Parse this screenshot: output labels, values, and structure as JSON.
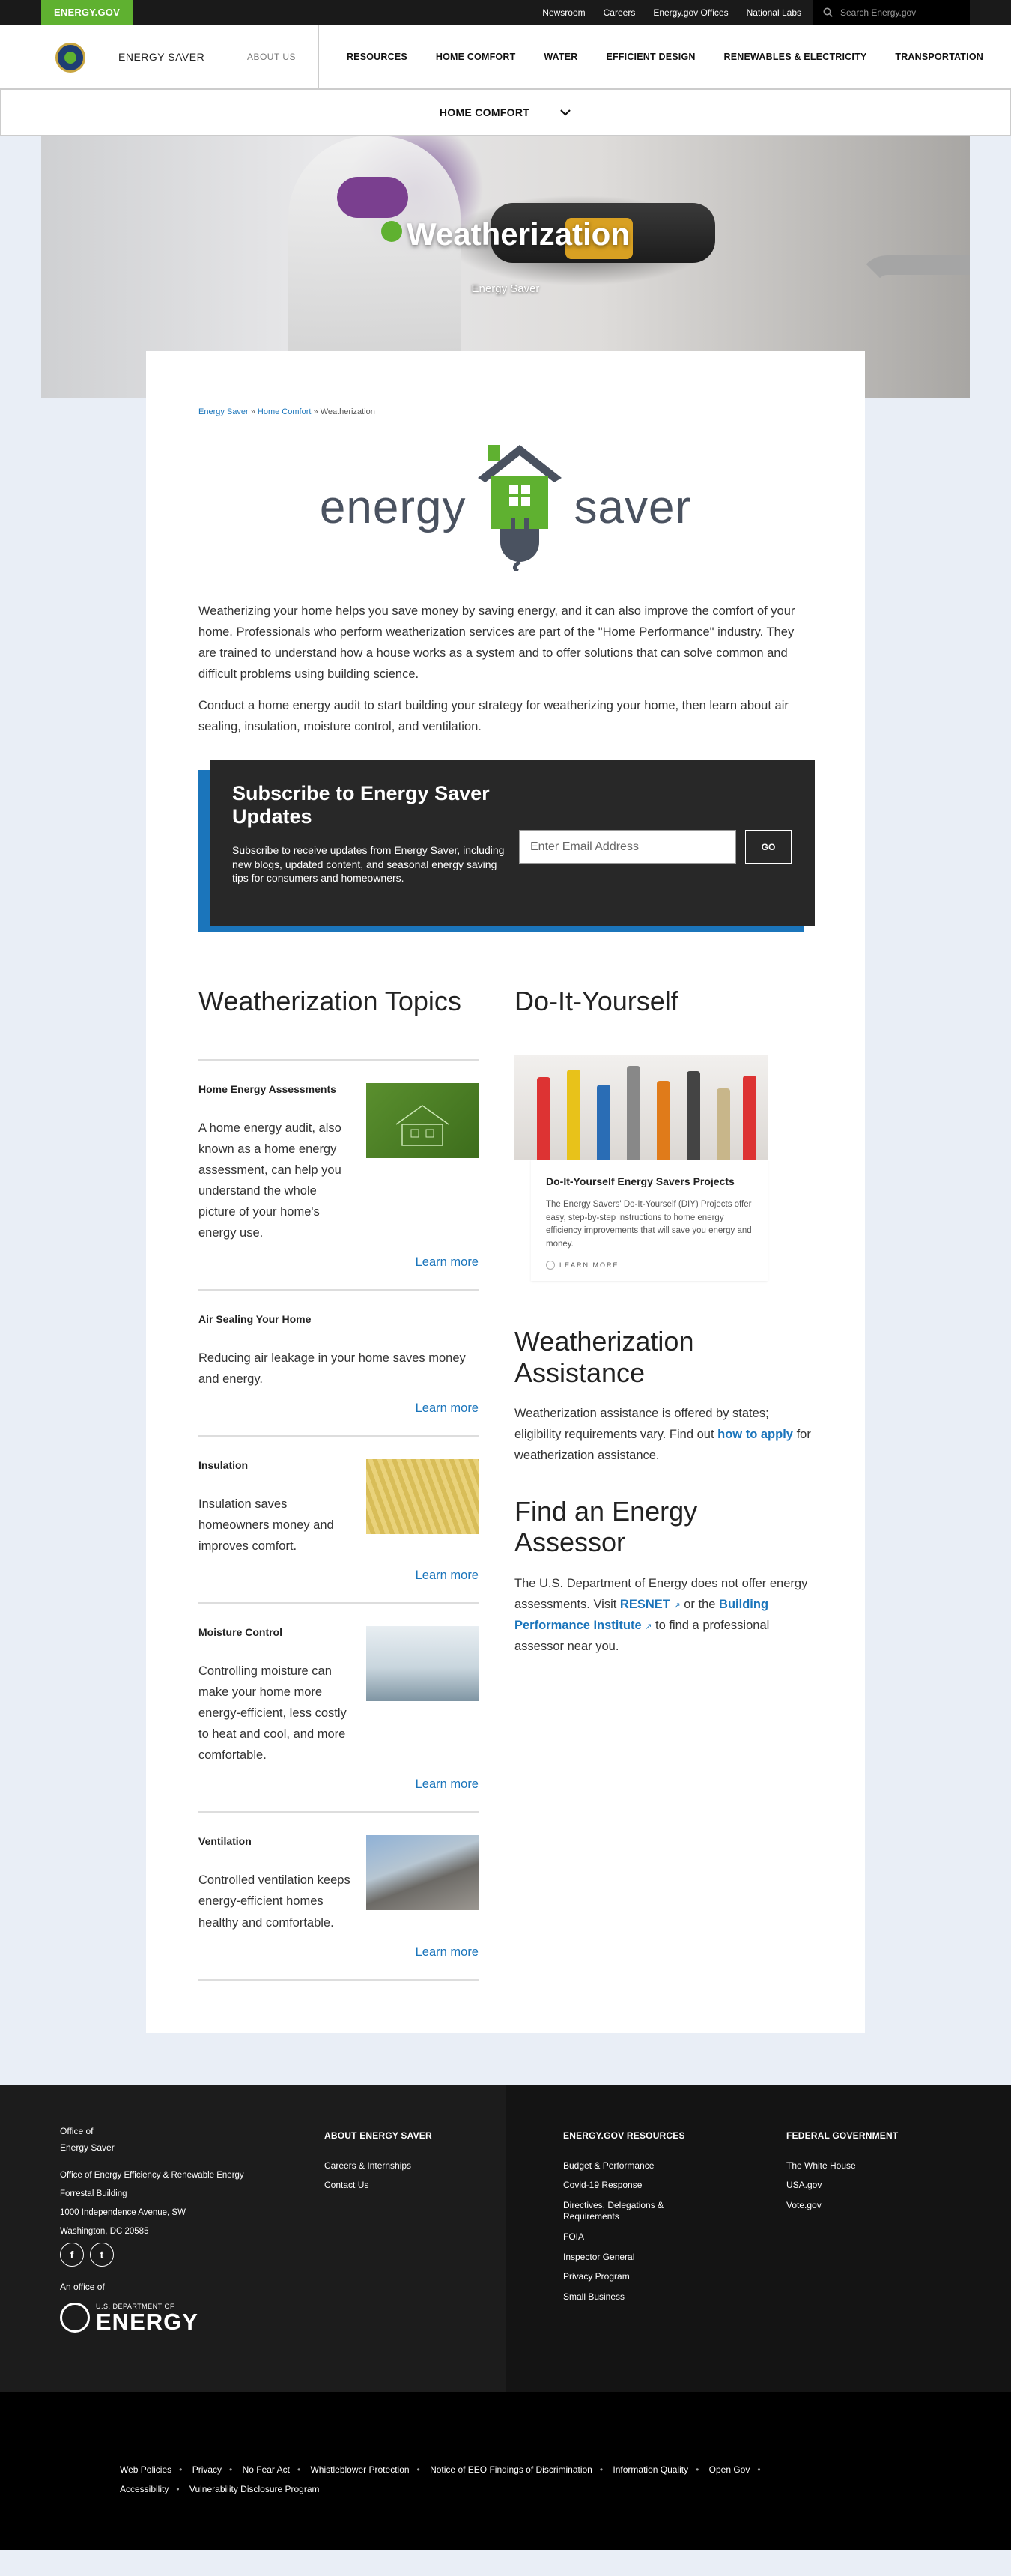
{
  "utility": {
    "brand": "ENERGY.GOV",
    "links": [
      "Newsroom",
      "Careers",
      "Energy.gov Offices",
      "National Labs"
    ],
    "search_placeholder": "Search Energy.gov"
  },
  "header": {
    "site_name": "ENERGY SAVER",
    "about": "ABOUT US",
    "nav": [
      "RESOURCES",
      "HOME COMFORT",
      "WATER",
      "EFFICIENT DESIGN",
      "RENEWABLES & ELECTRICITY",
      "TRANSPORTATION"
    ]
  },
  "subnav": {
    "label": "HOME COMFORT"
  },
  "hero": {
    "title": "Weatherization",
    "subtitle": "Energy Saver"
  },
  "breadcrumb": {
    "level1": "Energy Saver",
    "sep": "»",
    "level2": "Home Comfort",
    "current": "Weatherization"
  },
  "logo": {
    "left": "energy",
    "right": "saver"
  },
  "intro": {
    "p1": "Weatherizing your home helps you save money by saving energy, and it can also improve the comfort of your home. Professionals who perform weatherization services are part of the \"Home Performance\" industry.  They are trained to understand how a house works as a system and to offer solutions that can solve common and difficult problems using building science.",
    "p2": "Conduct a home energy audit to start building your strategy for weatherizing your home, then learn about air sealing, insulation, moisture control, and ventilation."
  },
  "subscribe": {
    "title": "Subscribe to Energy Saver Updates",
    "text": "Subscribe to receive updates from Energy Saver, including new blogs, updated content, and seasonal energy saving tips for consumers and homeowners.",
    "placeholder": "Enter Email Address",
    "button": "GO"
  },
  "topics": {
    "heading": "Weatherization Topics",
    "learn_more": "Learn more",
    "items": [
      {
        "title": "Home Energy Assessments",
        "text": "A home energy audit, also known as a home energy assessment, can help you understand the whole picture of your home's energy use."
      },
      {
        "title": "Air Sealing Your Home",
        "text": "Reducing air leakage in your home saves money and energy."
      },
      {
        "title": "Insulation",
        "text": "Insulation saves homeowners money and improves comfort."
      },
      {
        "title": "Moisture Control",
        "text": "Controlling moisture can make your home more energy-efficient, less costly to heat and cool, and more comfortable."
      },
      {
        "title": "Ventilation",
        "text": "Controlled ventilation keeps energy-efficient homes healthy and comfortable."
      }
    ]
  },
  "diy": {
    "heading": "Do-It-Yourself",
    "card_title": "Do-It-Yourself Energy Savers Projects",
    "card_text": "The Energy Savers' Do-It-Yourself (DIY) Projects offer easy, step-by-step instructions to home energy efficiency improvements that will save you energy and money.",
    "card_more": "LEARN MORE"
  },
  "assistance": {
    "heading": "Weatherization Assistance",
    "text_before": "Weatherization assistance is offered by states; eligibility requirements vary. Find out ",
    "link": "how to apply",
    "text_after": " for weatherization assistance."
  },
  "assessor": {
    "heading": "Find an Energy Assessor",
    "text1": "The U.S. Department of Energy does not offer energy assessments. Visit ",
    "link1": "RESNET",
    "text2": " or the ",
    "link2": "Building Performance Institute",
    "text3": "  to find a professional assessor near you."
  },
  "footer": {
    "office_line1": "Office of",
    "office_line2": "Energy Saver",
    "address": [
      "Office of Energy Efficiency & Renewable Energy",
      "Forrestal Building",
      "1000 Independence Avenue, SW",
      "Washington, DC 20585"
    ],
    "an_office": "An office of",
    "doe_small": "U.S. DEPARTMENT OF",
    "doe_big": "ENERGY",
    "col1": {
      "title": "ABOUT ENERGY SAVER",
      "links": [
        "Careers & Internships",
        "Contact Us"
      ]
    },
    "col2": {
      "title": "ENERGY.GOV RESOURCES",
      "links": [
        "Budget & Performance",
        "Covid-19 Response",
        "Directives, Delegations & Requirements",
        "FOIA",
        "Inspector General",
        "Privacy Program",
        "Small Business"
      ]
    },
    "col3": {
      "title": "FEDERAL GOVERNMENT",
      "links": [
        "The White House",
        "USA.gov",
        "Vote.gov"
      ]
    }
  },
  "bottom_links": [
    "Web Policies",
    "Privacy",
    "No Fear Act",
    "Whistleblower Protection",
    "Notice of EEO Findings of Discrimination",
    "Information Quality",
    "Open Gov",
    "Accessibility",
    "Vulnerability Disclosure Program"
  ],
  "colors": {
    "brand_green": "#5fb130",
    "link_blue": "#1b75bb",
    "dark": "#1a1a1a"
  }
}
